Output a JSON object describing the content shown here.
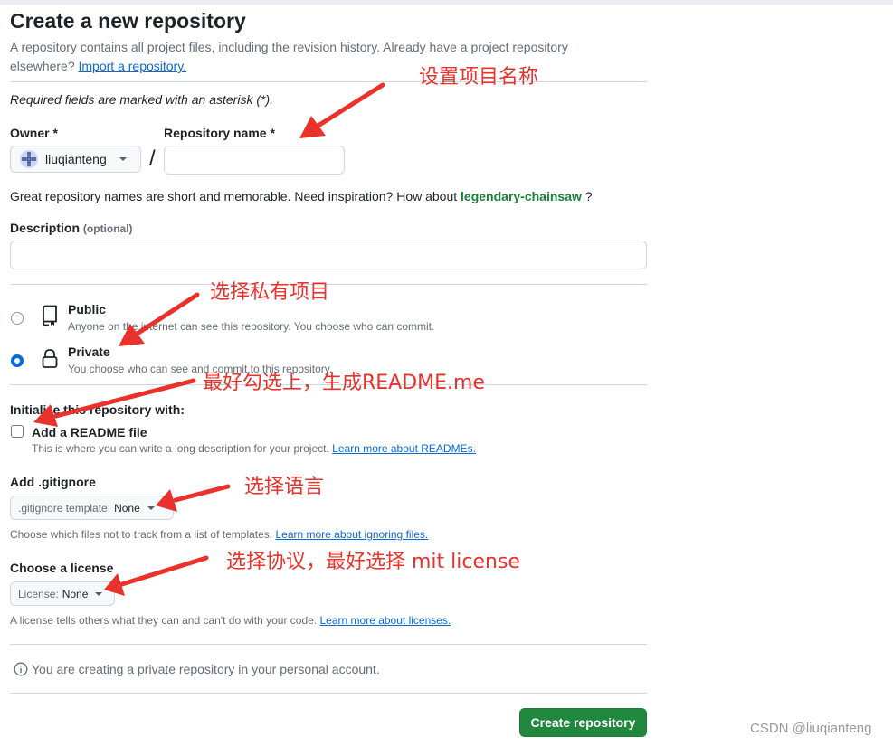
{
  "header": {
    "title": "Create a new repository",
    "intro_text": "A repository contains all project files, including the revision history. Already have a project repository",
    "intro_text_line2": "elsewhere?",
    "import_link": "Import a repository.",
    "required_note": "Required fields are marked with an asterisk (*)."
  },
  "owner": {
    "label": "Owner *",
    "value": "liuqianteng",
    "separator": "/"
  },
  "repo_name": {
    "label": "Repository name *",
    "value": "",
    "placeholder": ""
  },
  "name_hint": {
    "text": "Great repository names are short and memorable. Need inspiration? How about",
    "suggestion": "legendary-chainsaw",
    "end": "?"
  },
  "description": {
    "label": "Description",
    "optional": "(optional)",
    "value": ""
  },
  "visibility": {
    "public_label": "Public",
    "public_desc": "Anyone on the internet can see this repository. You choose who can commit.",
    "private_label": "Private",
    "private_desc": "You choose who can see and commit to this repository.",
    "selected": "Private"
  },
  "init": {
    "heading": "Initialize this repository with:",
    "readme_label": "Add a README file",
    "readme_checked": false,
    "readme_desc": "This is where you can write a long description for your project.",
    "readme_link": "Learn more about READMEs."
  },
  "gitignore": {
    "label": "Add .gitignore",
    "select_prefix": ".gitignore template:",
    "select_value": "None",
    "desc": "Choose which files not to track from a list of templates.",
    "link": "Learn more about ignoring files."
  },
  "license": {
    "label": "Choose a license",
    "select_prefix": "License:",
    "select_value": "None",
    "desc": "A license tells others what they can and can't do with your code.",
    "link": "Learn more about licenses."
  },
  "notice": {
    "text": "You are creating a private repository in your personal account."
  },
  "actions": {
    "create_label": "Create repository"
  },
  "annotations": {
    "name": "设置项目名称",
    "private": "选择私有项目",
    "readme": "最好勾选上，生成README.me",
    "language": "选择语言",
    "license": "选择协议，最好选择 mit license",
    "color": "#e8322b"
  },
  "watermark": "CSDN @liuqianteng",
  "colors": {
    "primary_button": "#1f883d",
    "link": "#0969da",
    "suggestion": "#1a7f37",
    "radio_selected": "#0969da"
  }
}
